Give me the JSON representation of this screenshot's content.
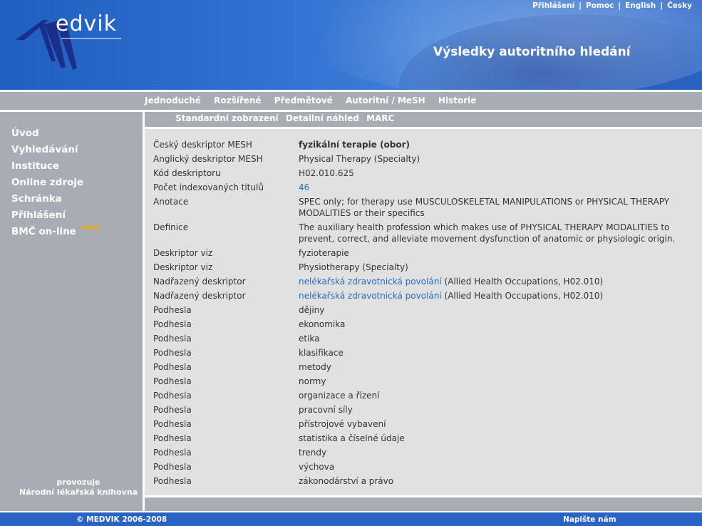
{
  "header": {
    "logo_text": "edvik",
    "page_title": "Výsledky autoritního hledání",
    "top_links": [
      "Přihlášení",
      "Pomoc",
      "English",
      "Česky"
    ]
  },
  "search_tabs": [
    "Jednoduché",
    "Rozšířené",
    "Předmětové",
    "Autoritní / MeSH",
    "Historie"
  ],
  "view_tabs": [
    "Standardní zobrazení",
    "Detailní náhled",
    "MARC"
  ],
  "sidebar": {
    "items": [
      "Úvod",
      "Vyhledávání",
      "Instituce",
      "Online zdroje",
      "Schránka",
      "Přihlášení",
      "BMČ on-line"
    ],
    "new_badge": "nová",
    "operator_line1": "provozuje",
    "operator_line2": "Národní lékařská knihovna"
  },
  "record": {
    "czech_descriptor_label": "Český deskriptor MESH",
    "czech_descriptor_value": "fyzikální terapie (obor)",
    "english_descriptor_label": "Anglický deskriptor MESH",
    "english_descriptor_value": "Physical Therapy (Specialty)",
    "code_label": "Kód deskriptoru",
    "code_value": "H02.010.625",
    "count_label": "Počet indexovaných titulů",
    "count_value": "46",
    "annotation_label": "Anotace",
    "annotation_value": "SPEC only; for therapy use MUSCULOSKELETAL MANIPULATIONS or PHYSICAL THERAPY MODALITIES or their specifics",
    "definition_label": "Definice",
    "definition_value": "The auxiliary health profession which makes use of PHYSICAL THERAPY MODALITIES to prevent, correct, and alleviate movement dysfunction of anatomic or physiologic origin.",
    "see_label": "Deskriptor viz",
    "see_values": [
      "fyzioterapie",
      "Physiotherapy (Specialty)"
    ],
    "parent_label": "Nadřazený deskriptor",
    "parents": [
      {
        "link": "nelékařská zdravotnická povolání",
        "suffix": " (Allied Health Occupations, H02.010)"
      },
      {
        "link": "nelékařská zdravotnická povolání",
        "suffix": " (Allied Health Occupations, H02.010)"
      }
    ],
    "subheading_label": "Podhesla",
    "subheadings": [
      "dějiny",
      "ekonomika",
      "etika",
      "klasifikace",
      "metody",
      "normy",
      "organizace a řízení",
      "pracovní síly",
      "přístrojové vybavení",
      "statistika a číselné údaje",
      "trendy",
      "výchova",
      "zákonodárství a právo"
    ]
  },
  "footer": {
    "copyright": "© MEDVIK 2006-2008",
    "contact": "Napište nám"
  },
  "colors": {
    "header_blue": "#2a63c6",
    "panel_grey": "#a7adb3",
    "content_grey": "#e1e1e1",
    "link_blue": "#2a6cbf",
    "new_orange": "#ffa500"
  }
}
